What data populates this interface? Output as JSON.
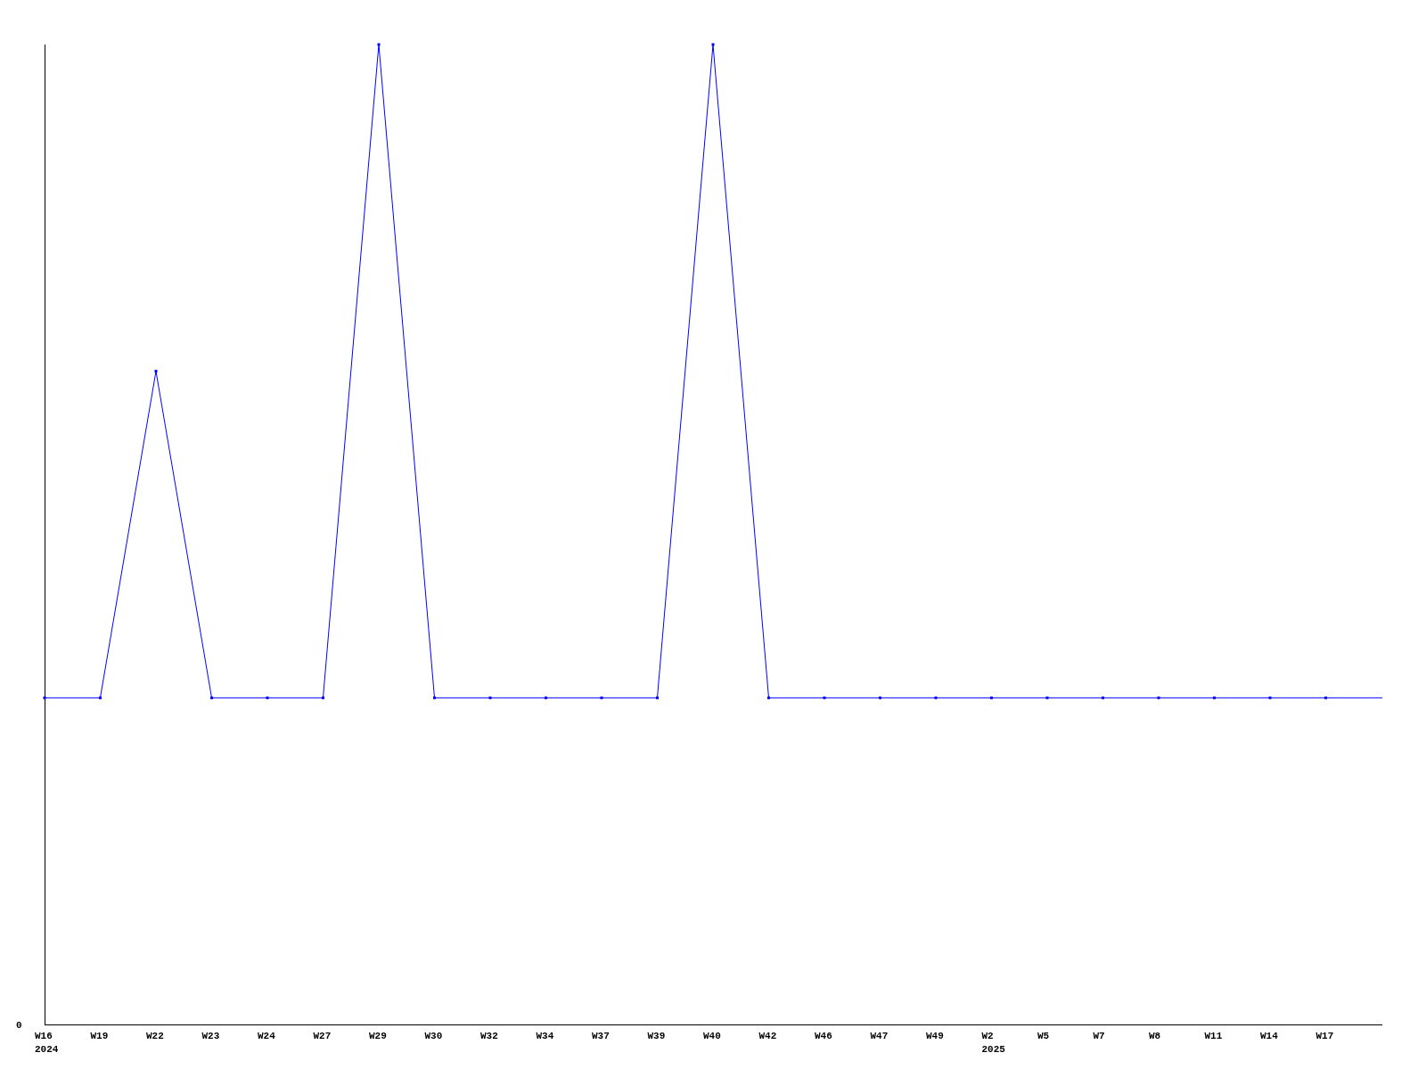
{
  "chart": {
    "y_tick_label": "0",
    "x_labels": [
      {
        "week": "W16",
        "year": "2024"
      },
      {
        "week": "W19"
      },
      {
        "week": "W22"
      },
      {
        "week": "W23"
      },
      {
        "week": "W24"
      },
      {
        "week": "W27"
      },
      {
        "week": "W29"
      },
      {
        "week": "W30"
      },
      {
        "week": "W32"
      },
      {
        "week": "W34"
      },
      {
        "week": "W37"
      },
      {
        "week": "W39"
      },
      {
        "week": "W40"
      },
      {
        "week": "W42"
      },
      {
        "week": "W46"
      },
      {
        "week": "W47"
      },
      {
        "week": "W49"
      },
      {
        "week": "W2",
        "year": "2025"
      },
      {
        "week": "W5"
      },
      {
        "week": "W7"
      },
      {
        "week": "W8"
      },
      {
        "week": "W11"
      },
      {
        "week": "W14"
      },
      {
        "week": "W17"
      }
    ]
  }
}
